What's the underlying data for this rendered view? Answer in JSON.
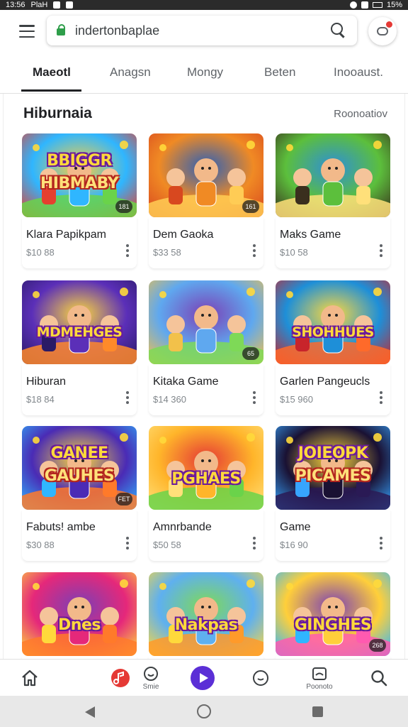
{
  "status_bar": {
    "time": "13:56",
    "carrier": "PlaH",
    "battery": "15%"
  },
  "browser": {
    "url": "indertonbaplae",
    "lock_icon": "lock-icon",
    "search_icon": "search-icon",
    "menu_icon": "hamburger-menu-icon",
    "profile_icon": "profile-icon",
    "notification_color": "#e53935"
  },
  "tabs": [
    {
      "label": "Maeotl",
      "active": true
    },
    {
      "label": "Anagsn",
      "active": false
    },
    {
      "label": "Mongy",
      "active": false
    },
    {
      "label": "Beten",
      "active": false
    },
    {
      "label": "Inooaust.",
      "active": false
    }
  ],
  "section": {
    "title": "Hiburnaia",
    "link": "Roonoatiov"
  },
  "cards": [
    {
      "title": "Klara Papikpam",
      "price": "$10 88",
      "banner": "BBIGGR",
      "banner2": "HIBMABY",
      "badge": "181",
      "palette": [
        "#2fb6ff",
        "#6ad34a",
        "#ffcf3a",
        "#e5402f"
      ]
    },
    {
      "title": "Dem Gaoka",
      "price": "$33 58",
      "banner": "",
      "banner2": "",
      "badge": "161",
      "palette": [
        "#f08a24",
        "#ffcc55",
        "#2a5fb8",
        "#d8481f"
      ]
    },
    {
      "title": "Maks Game",
      "price": "$10 58",
      "banner": "",
      "banner2": "",
      "badge": "",
      "palette": [
        "#5cbf3c",
        "#ffe07a",
        "#2e8fd8",
        "#3a2f1e"
      ]
    },
    {
      "title": "Hiburan",
      "price": "$18 84",
      "banner": "MDMEHGES",
      "banner2": "",
      "badge": "",
      "palette": [
        "#5b2fb8",
        "#ff8a2a",
        "#ffd93b",
        "#2a1a66"
      ]
    },
    {
      "title": "Kitaka Game",
      "price": "$14 360",
      "banner": "",
      "banner2": "",
      "badge": "65",
      "palette": [
        "#5fa8ef",
        "#7ed957",
        "#7b3fb5",
        "#f2c14a"
      ]
    },
    {
      "title": "Garlen Pangeucls",
      "price": "$15 960",
      "banner": "SHOHHUES",
      "banner2": "",
      "badge": "",
      "palette": [
        "#1e8fd8",
        "#ff6a2a",
        "#ffd93b",
        "#c8242b"
      ]
    },
    {
      "title": "Fabuts! ambe",
      "price": "$30 88",
      "banner": "GANEE",
      "banner2": "GAUHES",
      "badge": "FET",
      "palette": [
        "#4a2bb5",
        "#ff7a2a",
        "#ffd93b",
        "#2fb6ff"
      ]
    },
    {
      "title": "Amnrbande",
      "price": "$50 58",
      "banner": "PGHAES",
      "banner2": "",
      "badge": "",
      "palette": [
        "#ffb52a",
        "#6ad34a",
        "#e53935",
        "#ffe07a"
      ]
    },
    {
      "title": "Game",
      "price": "$16 90",
      "banner": "JOIEOPK",
      "banner2": "PICAMES",
      "badge": "",
      "palette": [
        "#1a1133",
        "#2a1a55",
        "#ffd93b",
        "#37a5ff"
      ]
    },
    {
      "title": "",
      "price": "",
      "banner": "Dnes",
      "banner2": "",
      "badge": "",
      "palette": [
        "#e5287a",
        "#ff7a2a",
        "#7b3fb5",
        "#ffd93b"
      ]
    },
    {
      "title": "",
      "price": "",
      "banner": "Nakpas",
      "banner2": "",
      "badge": "",
      "palette": [
        "#5fb0ef",
        "#ff9a2a",
        "#7ed957",
        "#ffd93b"
      ]
    },
    {
      "title": "",
      "price": "",
      "banner": "GINGHES",
      "banner2": "",
      "badge": "268",
      "palette": [
        "#ffcf3a",
        "#ff5ab0",
        "#7b3fb5",
        "#2fb6ff"
      ]
    }
  ],
  "bottom_nav": [
    {
      "icon": "home-icon",
      "label": ""
    },
    {
      "icon": "music-icon",
      "label": "",
      "color": "#e53935"
    },
    {
      "icon": "smile-icon",
      "label": "Smie"
    },
    {
      "icon": "play-icon",
      "label": "",
      "color": "#5b2fd6"
    },
    {
      "icon": "chat-icon",
      "label": ""
    },
    {
      "icon": "profile-card-icon",
      "label": "Poonoto"
    },
    {
      "icon": "search-icon",
      "label": ""
    }
  ]
}
